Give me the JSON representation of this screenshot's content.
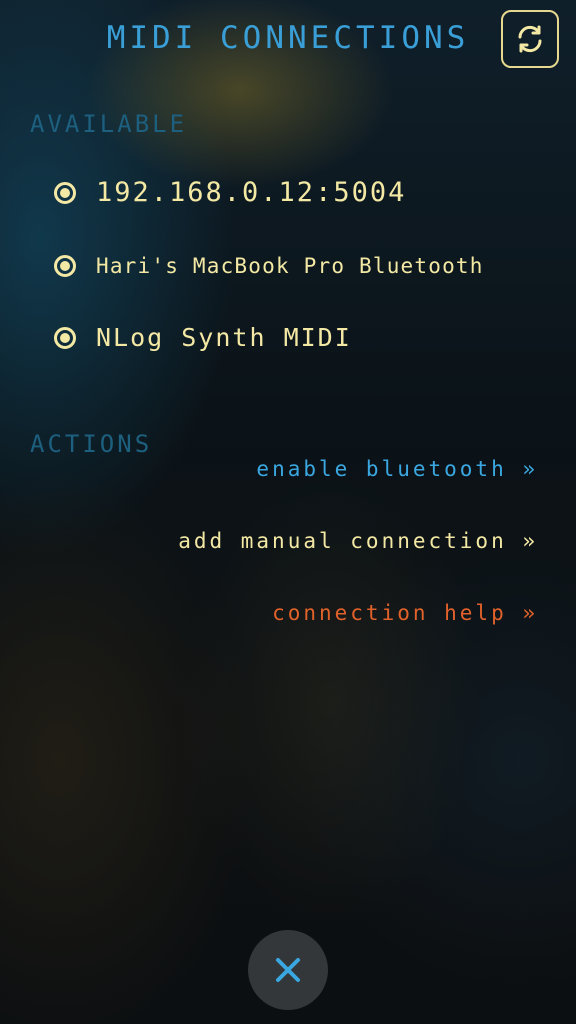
{
  "header": {
    "title": "MIDI CONNECTIONS",
    "refresh_icon": "refresh-icon"
  },
  "available": {
    "label": "AVAILABLE",
    "devices": [
      {
        "name": "192.168.0.12:5004",
        "selected": true
      },
      {
        "name": "Hari's MacBook Pro Bluetooth",
        "selected": true
      },
      {
        "name": "NLog Synth MIDI",
        "selected": true
      }
    ]
  },
  "actions": {
    "label": "ACTIONS",
    "links": [
      {
        "text": "enable bluetooth »",
        "color": "#3aa7e0"
      },
      {
        "text": "add manual connection »",
        "color": "#f3e8a4"
      },
      {
        "text": "connection help »",
        "color": "#e0612a"
      }
    ]
  },
  "footer": {
    "close_icon": "close-icon"
  },
  "colors": {
    "title": "#3a9fd6",
    "section_label": "#1d5f7e",
    "accent_yellow": "#f3e8a4",
    "close_x": "#3aa7e0"
  }
}
